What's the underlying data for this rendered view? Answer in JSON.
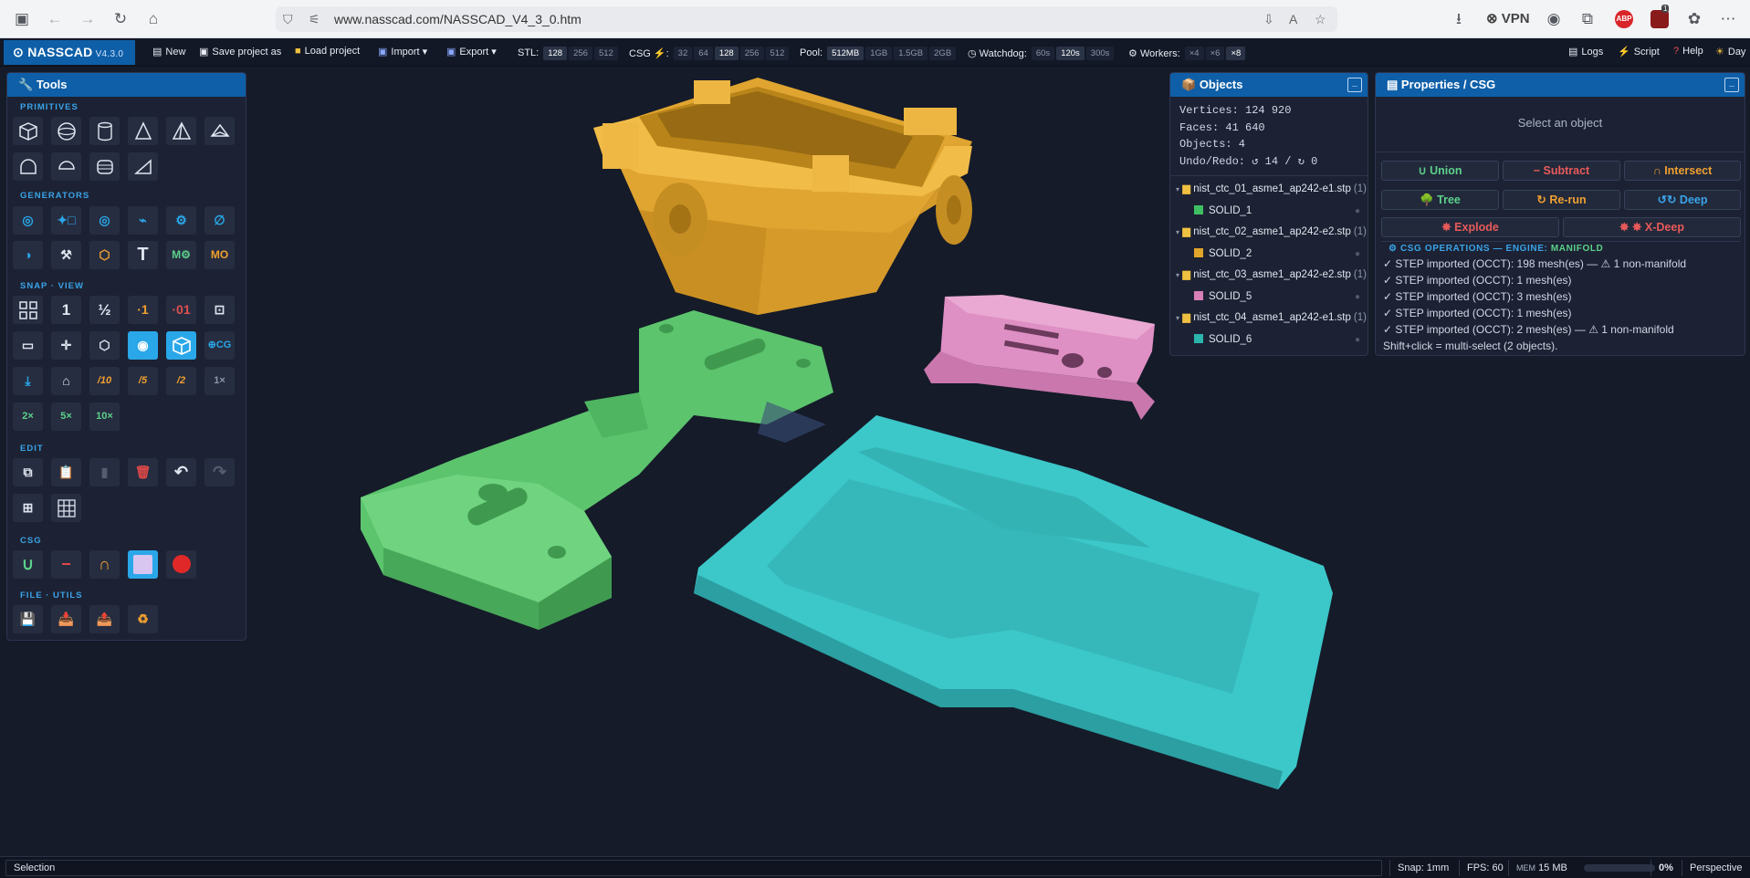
{
  "browser": {
    "url": "www.nasscad.com/NASSCAD_V4_3_0.htm",
    "vpn_label": "VPN",
    "abp_label": "ABP",
    "badge_count": "1"
  },
  "app": {
    "name": "NASSCAD",
    "version": "V4.3.0"
  },
  "toolbar": {
    "new": "New",
    "save": "Save project as",
    "load": "Load project",
    "import": "Import",
    "export": "Export",
    "stl_label": "STL:",
    "stl_options": [
      "128",
      "256",
      "512"
    ],
    "csg_label": "CSG",
    "csg_options": [
      "32",
      "64",
      "128",
      "256",
      "512"
    ],
    "pool_label": "Pool:",
    "pool_options": [
      "512MB",
      "1GB",
      "1.5GB",
      "2GB"
    ],
    "watchdog_label": "Watchdog:",
    "watchdog_options": [
      "60s",
      "120s",
      "300s"
    ],
    "workers_label": "Workers:",
    "workers_options": [
      "×4",
      "×6",
      "×8"
    ],
    "logs": "Logs",
    "script": "Script",
    "help": "Help",
    "day": "Day"
  },
  "tools": {
    "title": "Tools",
    "sections": {
      "primitives": "PRIMITIVES",
      "generators": "GENERATORS",
      "snap_view": "SNAP · VIEW",
      "edit": "EDIT",
      "csg": "CSG",
      "file_utils": "FILE · UTILS"
    },
    "snap_labels": [
      "1",
      "½",
      "·1",
      "·01"
    ],
    "csg_view_label": "⊕CG",
    "snap_fractions": [
      "/10",
      "/5",
      "/2",
      "1×"
    ],
    "multipliers": [
      "2×",
      "5×",
      "10×"
    ]
  },
  "objects": {
    "title": "Objects",
    "vertices": "Vertices: 124 920",
    "faces": "Faces: 41 640",
    "objects": "Objects: 4",
    "undo": "Undo/Redo: ↺ 14 / ↻ 0",
    "tree": [
      {
        "file": "nist_ctc_01_asme1_ap242-e1.stp",
        "count": "(1)",
        "solid": "SOLID_1",
        "color": "#3fbf63"
      },
      {
        "file": "nist_ctc_02_asme1_ap242-e2.stp",
        "count": "(1)",
        "solid": "SOLID_2",
        "color": "#e0a52a"
      },
      {
        "file": "nist_ctc_03_asme1_ap242-e2.stp",
        "count": "(1)",
        "solid": "SOLID_5",
        "color": "#d77fb7"
      },
      {
        "file": "nist_ctc_04_asme1_ap242-e1.stp",
        "count": "(1)",
        "solid": "SOLID_6",
        "color": "#2bb5ac"
      }
    ]
  },
  "properties": {
    "title": "Properties / CSG",
    "hint": "Select an object",
    "union": "∪ Union",
    "subtract": "− Subtract",
    "intersect": "∩ Intersect",
    "tree": "Tree",
    "rerun": "↻ Re-run",
    "deep": "↺↻ Deep",
    "explode": "Explode",
    "xdeep": "X-Deep",
    "ops_title": "CSG OPERATIONS — ENGINE:",
    "engine": "MANIFOLD",
    "log": [
      "✓ STEP imported (OCCT): 198 mesh(es) — ⚠ 1 non-manifold",
      "✓ STEP imported (OCCT): 1 mesh(es)",
      "✓ STEP imported (OCCT): 3 mesh(es)",
      "✓ STEP imported (OCCT): 1 mesh(es)",
      "✓ STEP imported (OCCT): 2 mesh(es) — ⚠ 1 non-manifold",
      "Shift+click = multi-select (2 objects)."
    ]
  },
  "status": {
    "mode": "Selection",
    "snap": "Snap: 1mm",
    "fps": "FPS: 60",
    "mem_label": "MEM",
    "mem_value": "15 MB",
    "progress": "0%",
    "progress_value": 0,
    "projection": "Perspective"
  },
  "colors": {
    "accent": "#0e5fa8",
    "highlight": "#2aa7e8",
    "green_part": "#5cc46d",
    "gold_part": "#e8ad3a",
    "pink_part": "#de8fc3",
    "teal_part": "#3cc7c9"
  }
}
